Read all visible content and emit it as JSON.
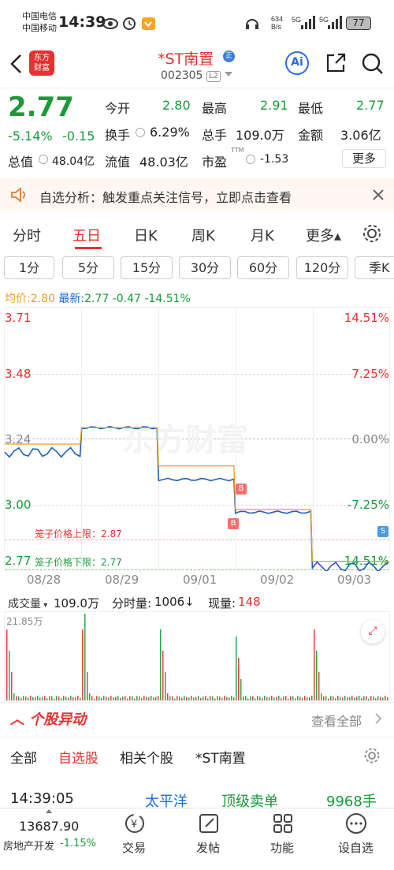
{
  "status": {
    "carrier1": "中国电信",
    "carrier2": "中国移动",
    "time": "14:39",
    "net": "634\nB/s",
    "battery": "77"
  },
  "header": {
    "logo": "东方\n财富",
    "title": "*ST南置",
    "code": "002305",
    "level": "L2",
    "ai": "Ai"
  },
  "quote": {
    "price": "2.77",
    "pct": "-5.14%",
    "chg": "-0.15",
    "open_l": "今开",
    "open": "2.80",
    "high_l": "最高",
    "high": "2.91",
    "low_l": "最低",
    "low": "2.77",
    "turn_l": "换手",
    "turn": "6.29%",
    "vol_l": "总手",
    "vol": "109.0万",
    "amt_l": "金额",
    "amt": "3.06亿",
    "mcap_l": "总值",
    "mcap": "48.04亿",
    "fcap_l": "流值",
    "fcap": "48.03亿",
    "pe_l": "市盈",
    "pe_sup": "TTM",
    "pe": "-1.53",
    "more": "更多"
  },
  "notice": {
    "text": "自选分析：触发重点关注信号，立即点击查看"
  },
  "tabs": [
    "分时",
    "五日",
    "日K",
    "周K",
    "月K",
    "更多▴"
  ],
  "periods": [
    "1分",
    "5分",
    "15分",
    "30分",
    "60分",
    "120分",
    "季K"
  ],
  "legend": {
    "avg_l": "均价:",
    "avg": "2.80",
    "last_l": "最新:",
    "last": "2.77",
    "chg": "-0.47",
    "pct": "-14.51%"
  },
  "chart_axes": {
    "y_left": [
      "3.71",
      "3.48",
      "3.24",
      "3.00",
      "2.77"
    ],
    "y_right": [
      "14.51%",
      "7.25%",
      "0.00%",
      "-7.25%",
      "-14.51%"
    ],
    "x": [
      "08/28",
      "08/29",
      "09/01",
      "09/02",
      "09/03"
    ],
    "upper_limit": "笼子价格上限：2.87",
    "lower_limit": "笼子价格下限：2.77",
    "watermark": "东方财富",
    "markers": [
      "B",
      "B",
      "S"
    ]
  },
  "chart_data": {
    "type": "line",
    "title": "",
    "x": [
      "08/28",
      "08/29",
      "09/01",
      "09/02",
      "09/03"
    ],
    "ylim": [
      2.77,
      3.71
    ],
    "series": [
      {
        "name": "最新",
        "values": [
          3.2,
          3.29,
          3.1,
          2.98,
          2.78
        ]
      },
      {
        "name": "均价",
        "values": [
          3.23,
          3.29,
          3.15,
          2.99,
          2.8
        ]
      }
    ]
  },
  "volume": {
    "label": "成交量",
    "total": "109.0万",
    "fen_l": "分时量:",
    "fen": "1006↓",
    "now_l": "现量:",
    "now": "148",
    "max": "21.85万"
  },
  "movers": {
    "title": "个股异动",
    "viewall": "查看全部",
    "tabs": [
      "全部",
      "自选股",
      "相关个股",
      "*ST南置"
    ],
    "row": {
      "time": "14:39:05",
      "who": "太平洋",
      "type": "顶级卖单",
      "qty": "9968手"
    }
  },
  "bottom": {
    "index": "13687.90",
    "sector": "房地产开发",
    "sector_pct": "-1.15%",
    "items": [
      "交易",
      "发帖",
      "功能",
      "设自选"
    ]
  }
}
